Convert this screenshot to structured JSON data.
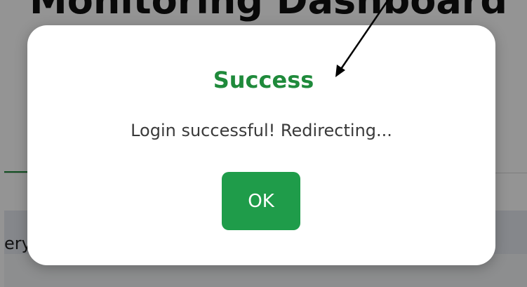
{
  "page": {
    "title": "Monitoring Dashboard",
    "row_text": "ery"
  },
  "modal": {
    "title": "Success",
    "message": "Login successful! Redirecting...",
    "ok_label": "OK"
  },
  "colors": {
    "success_green": "#1f8a3b",
    "button_green": "#1f9c4a"
  }
}
